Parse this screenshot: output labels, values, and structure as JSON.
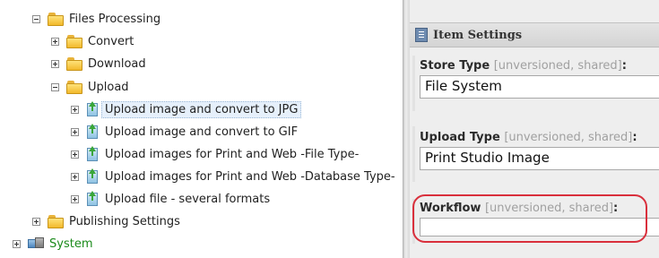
{
  "tree": {
    "files_processing": "Files Processing",
    "convert": "Convert",
    "download": "Download",
    "upload": "Upload",
    "upload_items": [
      "Upload image and convert to JPG",
      "Upload image and convert to GIF",
      "Upload images for Print and Web -File Type-",
      "Upload images for Print and Web -Database Type-",
      "Upload file - several formats"
    ],
    "publishing_settings": "Publishing Settings",
    "system": "System"
  },
  "editor": {
    "section_title": "Item Settings",
    "fields": [
      {
        "label": "Store Type",
        "meta": "[unversioned, shared]",
        "colon": ":",
        "value": "File System"
      },
      {
        "label": "Upload Type",
        "meta": "[unversioned, shared]",
        "colon": ":",
        "value": "Print Studio Image"
      },
      {
        "label": "Workflow",
        "meta": "[unversioned, shared]",
        "colon": ":",
        "value": ""
      }
    ]
  },
  "colors": {
    "highlight": "#d92f3c",
    "system_label": "#1a8a1a",
    "selected_bg": "#e6f0fb"
  },
  "icons": {
    "folder": "folder-icon",
    "upload_item": "upload-item-icon",
    "system": "system-icon",
    "section": "document-icon"
  }
}
